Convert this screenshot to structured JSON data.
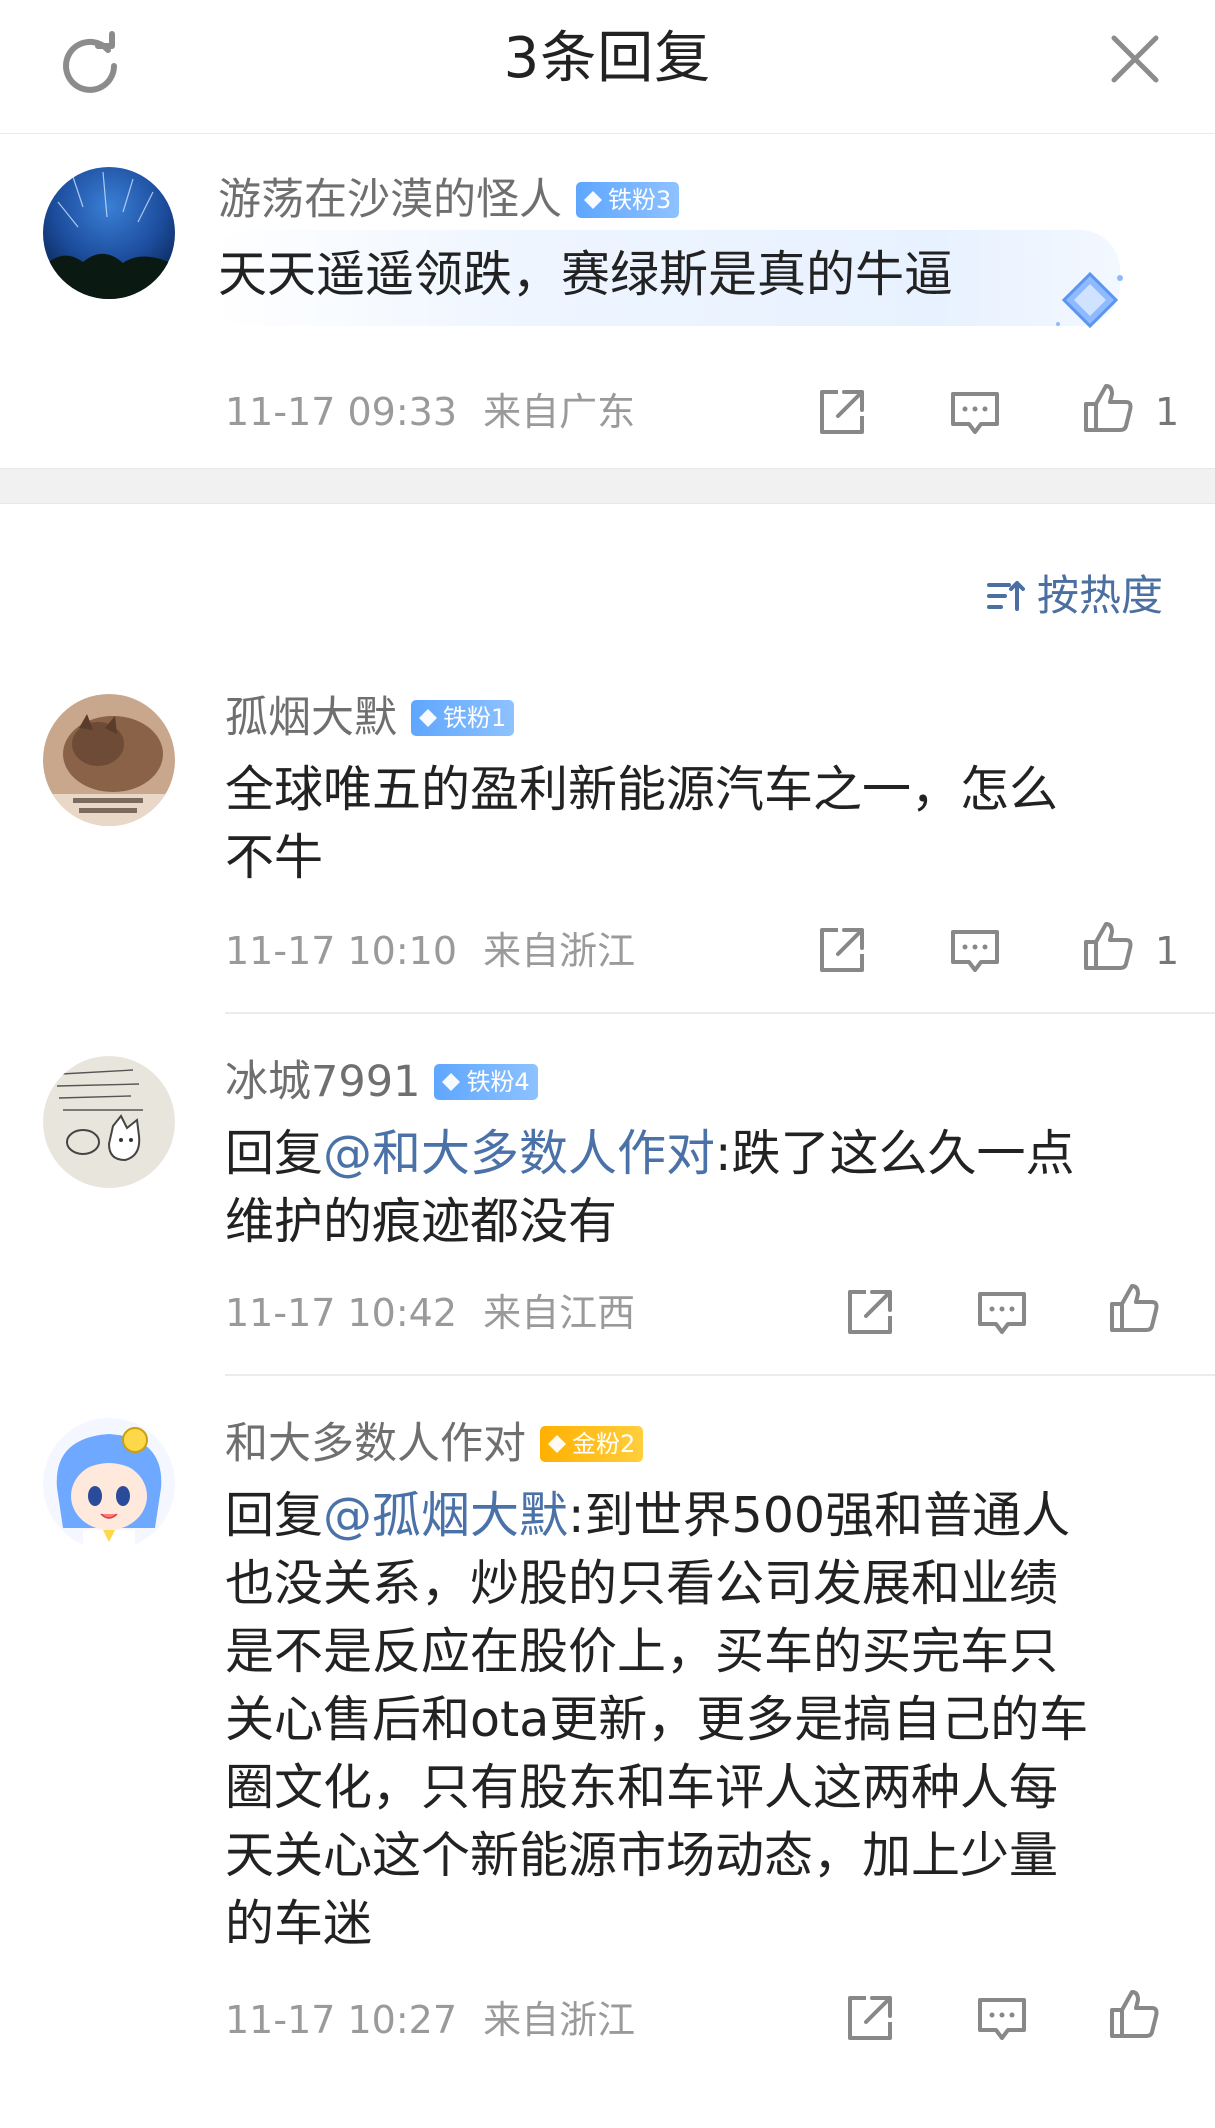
{
  "header": {
    "title": "3条回复"
  },
  "main_comment": {
    "username": "游荡在沙漠的怪人",
    "badge": "铁粉3",
    "text": "天天遥遥领跌，赛绿斯是真的牛逼",
    "time": "11-17 09:33",
    "location": "来自广东",
    "likes": "1"
  },
  "sort": {
    "label": "按热度"
  },
  "replies": [
    {
      "username": "孤烟大默",
      "badge": "铁粉1",
      "line1": "全球唯五的盈利新能源汽车之一，怎么",
      "line2": "不牛",
      "time": "11-17 10:10",
      "location": "来自浙江",
      "likes": "1"
    },
    {
      "username": "冰城7991",
      "badge": "铁粉4",
      "prefix": "回复",
      "mention": "@和大多数人作对",
      "line1_rest": ":跌了这么久一点",
      "line2": "维护的痕迹都没有",
      "time": "11-17 10:42",
      "location": "来自江西"
    },
    {
      "username": "和大多数人作对",
      "badge": "金粉2",
      "prefix": "回复",
      "mention": "@孤烟大默",
      "line1_rest": ":到世界500强和普通人",
      "line2": "也没关系，炒股的只看公司发展和业绩",
      "line3": "是不是反应在股价上，买车的买完车只",
      "line4": "关心售后和ota更新，更多是搞自己的车",
      "line5": "圈文化，只有股东和车评人这两种人每",
      "line6": "天关心这个新能源市场动态，加上少量",
      "line7": "的车迷",
      "time": "11-17 10:27",
      "location": "来自浙江"
    }
  ],
  "colors": {
    "mention": "#4a72a8",
    "badge_blue": "#6aaeff",
    "badge_gold": "#ffbb10",
    "meta_gray": "#9a9a9a"
  },
  "icons": [
    "refresh-icon",
    "close-icon",
    "share-icon",
    "comment-icon",
    "like-icon",
    "sort-icon",
    "diamond-icon"
  ]
}
